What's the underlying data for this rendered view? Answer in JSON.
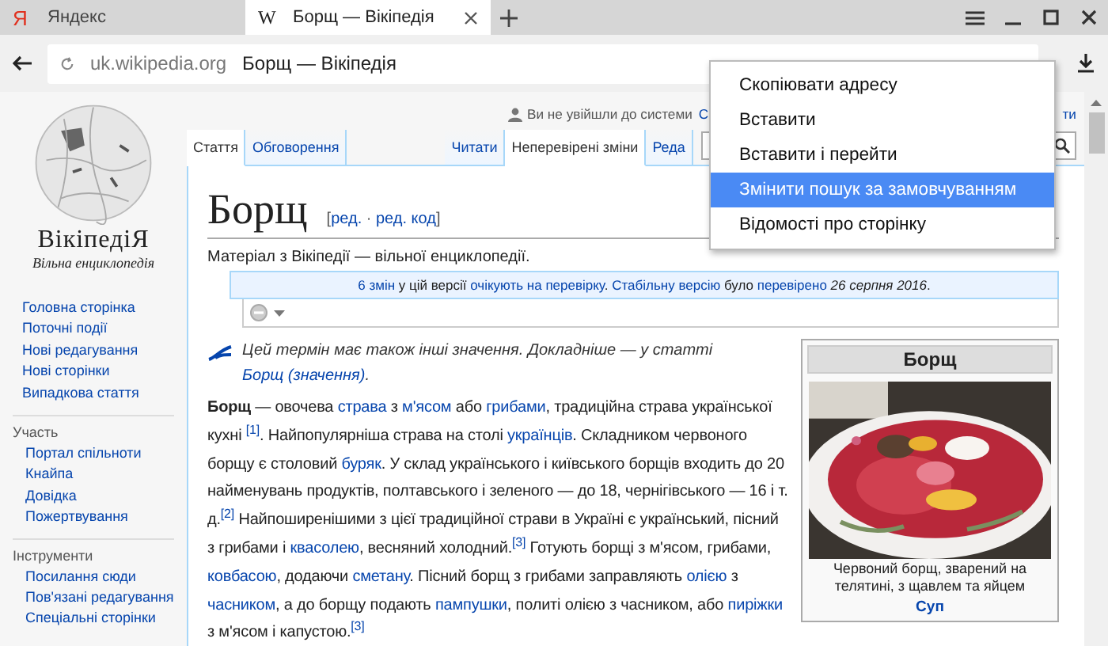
{
  "browser_tabs": [
    {
      "icon": "Я",
      "kind": "yandex",
      "title": "Яндекс",
      "selected": false
    },
    {
      "icon": "W",
      "kind": "wiki",
      "title": "Борщ — Вікіпедія",
      "selected": true
    }
  ],
  "address_bar": {
    "domain": "uk.wikipedia.org",
    "title": "Борщ — Вікіпедія"
  },
  "sidebar": {
    "logo_title": "ВікіпедіЯ",
    "logo_subtitle": "Вільна енциклопедія",
    "sections": [
      {
        "items": [
          "Головна сторінка",
          "Поточні події",
          "Нові редагування",
          "Нові сторінки",
          "Випадкова стаття"
        ]
      },
      {
        "heading": "Участь",
        "items": [
          "Портал спільноти",
          "Кнайпа",
          "Довідка",
          "Пожертвування"
        ]
      },
      {
        "heading": "Інструменти",
        "items": [
          "Посилання сюди",
          "Пов'язані редагування",
          "Спеціальні сторінки"
        ]
      }
    ]
  },
  "personal_bar": {
    "status": "Ви не увійшли до системи",
    "link_1": "С",
    "link_2": "ти"
  },
  "page_tabs": {
    "left": [
      {
        "label": "Стаття",
        "selected": true
      },
      {
        "label": "Обговорення",
        "selected": false
      }
    ],
    "right": [
      {
        "label": "Читати",
        "selected": false
      },
      {
        "label": "Неперевірені зміни",
        "selected": true
      },
      {
        "label": "Реда",
        "selected": false
      }
    ]
  },
  "article": {
    "title": "Борщ",
    "edit_links": [
      {
        "kind": "plain",
        "text": "["
      },
      {
        "kind": "link",
        "text": "ред."
      },
      {
        "kind": "plain",
        "text": " · "
      },
      {
        "kind": "link",
        "text": "ред. код"
      },
      {
        "kind": "plain",
        "text": "]"
      }
    ],
    "tagline": "Матеріал з Вікіпедії — вільної енциклопедії.",
    "review_notice": [
      {
        "kind": "link",
        "text": "6 змін"
      },
      {
        "kind": "plain",
        "text": " у цій версії "
      },
      {
        "kind": "link",
        "text": "очікують на перевірку"
      },
      {
        "kind": "plain",
        "text": ". "
      },
      {
        "kind": "link",
        "text": "Стабільну версію"
      },
      {
        "kind": "plain",
        "text": " було "
      },
      {
        "kind": "link",
        "text": "перевірено"
      },
      {
        "kind": "italic",
        "text": " 26 серпня 2016"
      },
      {
        "kind": "plain",
        "text": "."
      }
    ],
    "hatnote": [
      {
        "kind": "plain",
        "text": "Цей термін має також інші значення. Докладніше — у статті "
      },
      {
        "kind": "link",
        "text": "Борщ (значення)"
      },
      {
        "kind": "plain",
        "text": "."
      }
    ],
    "paragraph": [
      {
        "kind": "bold",
        "text": "Борщ"
      },
      {
        "kind": "plain",
        "text": " — овочева "
      },
      {
        "kind": "link",
        "text": "страва"
      },
      {
        "kind": "plain",
        "text": " з "
      },
      {
        "kind": "link",
        "text": "м'ясом"
      },
      {
        "kind": "plain",
        "text": " або "
      },
      {
        "kind": "link",
        "text": "грибами"
      },
      {
        "kind": "plain",
        "text": ", традиційна страва української кухні "
      },
      {
        "kind": "sup",
        "text": "[1]"
      },
      {
        "kind": "plain",
        "text": ". Найпопулярніша страва на столі "
      },
      {
        "kind": "link",
        "text": "українців"
      },
      {
        "kind": "plain",
        "text": ". Складником червоного борщу є столовий "
      },
      {
        "kind": "link",
        "text": "буряк"
      },
      {
        "kind": "plain",
        "text": ". У склад українського і київського борщів входить до 20 найменувань продуктів, полтавського і зеленого — до 18, чернігівського — 16 і т. д."
      },
      {
        "kind": "sup",
        "text": "[2]"
      },
      {
        "kind": "plain",
        "text": " Найпоширенішими з цієї традиційної страви в Україні є український, пісний з грибами і "
      },
      {
        "kind": "link",
        "text": "квасолею"
      },
      {
        "kind": "plain",
        "text": ", весняний холодний."
      },
      {
        "kind": "sup",
        "text": "[3]"
      },
      {
        "kind": "plain",
        "text": " Готують борщі з м'ясом, грибами, "
      },
      {
        "kind": "link",
        "text": "ковбасою"
      },
      {
        "kind": "plain",
        "text": ", додаючи "
      },
      {
        "kind": "link",
        "text": "сметану"
      },
      {
        "kind": "plain",
        "text": ". Пісний борщ з грибами заправляють "
      },
      {
        "kind": "link",
        "text": "олією"
      },
      {
        "kind": "plain",
        "text": " з "
      },
      {
        "kind": "link",
        "text": "часником"
      },
      {
        "kind": "plain",
        "text": ", а до борщу подають "
      },
      {
        "kind": "link",
        "text": "пампушки"
      },
      {
        "kind": "plain",
        "text": ", политі олією з часником, або "
      },
      {
        "kind": "link",
        "text": "пиріжки"
      },
      {
        "kind": "plain",
        "text": " з м'ясом і капустою."
      },
      {
        "kind": "sup",
        "text": "[3]"
      }
    ]
  },
  "infobox": {
    "title": "Борщ",
    "caption": "Червоний борщ, зварений на телятині, з щавлем та яйцем",
    "category": "Суп"
  },
  "context_menu": [
    {
      "label": "Скопіювати адресу",
      "selected": false
    },
    {
      "label": "Вставити",
      "selected": false
    },
    {
      "label": "Вставити і перейти",
      "selected": false
    },
    {
      "label": "Змінити пошук за замовчуванням",
      "selected": true
    },
    {
      "label": "Відомості про сторінку",
      "selected": false
    }
  ]
}
